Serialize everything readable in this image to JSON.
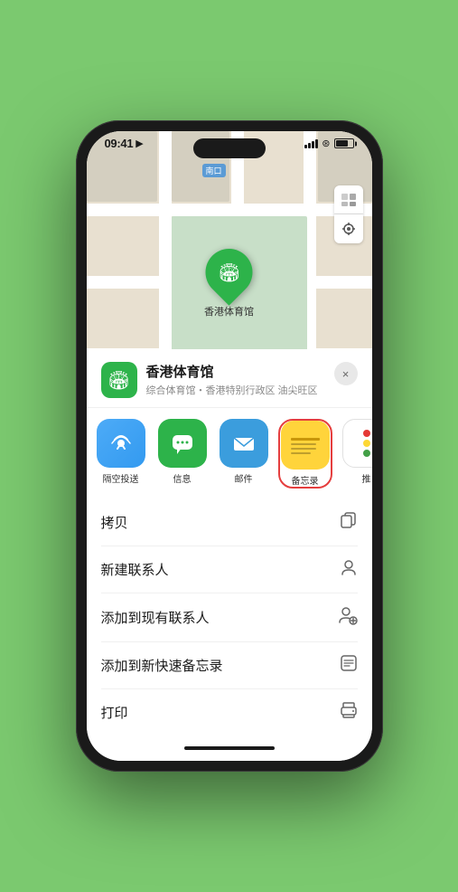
{
  "status_bar": {
    "time": "09:41",
    "location_arrow": "▶"
  },
  "map": {
    "label": "南口",
    "marker_label": "香港体育馆"
  },
  "location_card": {
    "name": "香港体育馆",
    "detail": "综合体育馆・香港特别行政区 油尖旺区",
    "close_label": "×"
  },
  "share_apps": [
    {
      "id": "airdrop",
      "label": "隔空投送",
      "icon": "airdrop"
    },
    {
      "id": "message",
      "label": "信息",
      "icon": "message"
    },
    {
      "id": "mail",
      "label": "邮件",
      "icon": "mail"
    },
    {
      "id": "notes",
      "label": "备忘录",
      "icon": "notes"
    },
    {
      "id": "more",
      "label": "推",
      "icon": "more"
    }
  ],
  "actions": [
    {
      "label": "拷贝",
      "icon": "copy"
    },
    {
      "label": "新建联系人",
      "icon": "person"
    },
    {
      "label": "添加到现有联系人",
      "icon": "person-add"
    },
    {
      "label": "添加到新快速备忘录",
      "icon": "note"
    },
    {
      "label": "打印",
      "icon": "print"
    }
  ],
  "colors": {
    "green": "#2db34a",
    "highlight_red": "#e53e3e",
    "bg": "#7bc96f"
  }
}
